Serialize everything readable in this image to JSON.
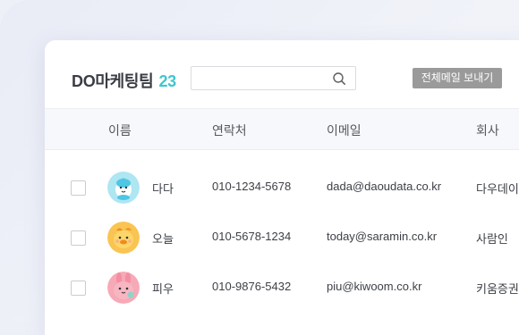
{
  "header": {
    "group_name": "DO마케팅팀",
    "count": "23",
    "send_button": "전체메일 보내기",
    "search_placeholder": ""
  },
  "columns": [
    "이름",
    "연락처",
    "이메일",
    "회사"
  ],
  "rows": [
    {
      "name": "다다",
      "phone": "010-1234-5678",
      "email": "dada@daoudata.co.kr",
      "company": "다우데이",
      "avatar": "blue-bird-character"
    },
    {
      "name": "오늘",
      "phone": "010-5678-1234",
      "email": "today@saramin.co.kr",
      "company": "사람인",
      "avatar": "yellow-duck-character"
    },
    {
      "name": "피우",
      "phone": "010-9876-5432",
      "email": "piu@kiwoom.co.kr",
      "company": "키움증권",
      "avatar": "pink-bunny-character"
    }
  ],
  "colors": {
    "count_accent": "#3fc6cf",
    "button_bg": "#9a9a9a",
    "avatar_blue": "#aee6f2",
    "avatar_yellow": "#f9c451",
    "avatar_pink": "#f6a9b6"
  }
}
